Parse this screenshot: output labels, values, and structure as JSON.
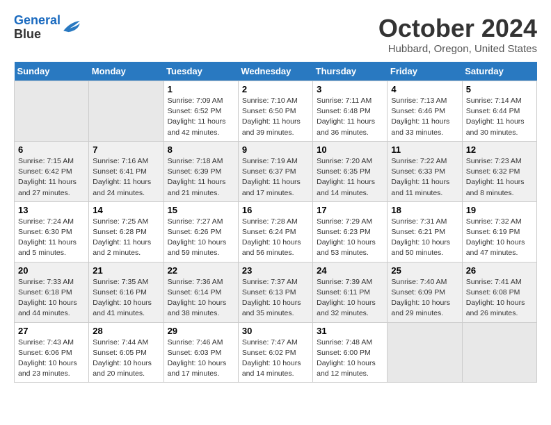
{
  "header": {
    "logo_line1": "General",
    "logo_line2": "Blue",
    "title": "October 2024",
    "location": "Hubbard, Oregon, United States"
  },
  "weekdays": [
    "Sunday",
    "Monday",
    "Tuesday",
    "Wednesday",
    "Thursday",
    "Friday",
    "Saturday"
  ],
  "weeks": [
    [
      {
        "day": "",
        "info": "",
        "empty": true
      },
      {
        "day": "",
        "info": "",
        "empty": true
      },
      {
        "day": "1",
        "info": "Sunrise: 7:09 AM\nSunset: 6:52 PM\nDaylight: 11 hours and 42 minutes."
      },
      {
        "day": "2",
        "info": "Sunrise: 7:10 AM\nSunset: 6:50 PM\nDaylight: 11 hours and 39 minutes."
      },
      {
        "day": "3",
        "info": "Sunrise: 7:11 AM\nSunset: 6:48 PM\nDaylight: 11 hours and 36 minutes."
      },
      {
        "day": "4",
        "info": "Sunrise: 7:13 AM\nSunset: 6:46 PM\nDaylight: 11 hours and 33 minutes."
      },
      {
        "day": "5",
        "info": "Sunrise: 7:14 AM\nSunset: 6:44 PM\nDaylight: 11 hours and 30 minutes."
      }
    ],
    [
      {
        "day": "6",
        "info": "Sunrise: 7:15 AM\nSunset: 6:42 PM\nDaylight: 11 hours and 27 minutes."
      },
      {
        "day": "7",
        "info": "Sunrise: 7:16 AM\nSunset: 6:41 PM\nDaylight: 11 hours and 24 minutes."
      },
      {
        "day": "8",
        "info": "Sunrise: 7:18 AM\nSunset: 6:39 PM\nDaylight: 11 hours and 21 minutes."
      },
      {
        "day": "9",
        "info": "Sunrise: 7:19 AM\nSunset: 6:37 PM\nDaylight: 11 hours and 17 minutes."
      },
      {
        "day": "10",
        "info": "Sunrise: 7:20 AM\nSunset: 6:35 PM\nDaylight: 11 hours and 14 minutes."
      },
      {
        "day": "11",
        "info": "Sunrise: 7:22 AM\nSunset: 6:33 PM\nDaylight: 11 hours and 11 minutes."
      },
      {
        "day": "12",
        "info": "Sunrise: 7:23 AM\nSunset: 6:32 PM\nDaylight: 11 hours and 8 minutes."
      }
    ],
    [
      {
        "day": "13",
        "info": "Sunrise: 7:24 AM\nSunset: 6:30 PM\nDaylight: 11 hours and 5 minutes."
      },
      {
        "day": "14",
        "info": "Sunrise: 7:25 AM\nSunset: 6:28 PM\nDaylight: 11 hours and 2 minutes."
      },
      {
        "day": "15",
        "info": "Sunrise: 7:27 AM\nSunset: 6:26 PM\nDaylight: 10 hours and 59 minutes."
      },
      {
        "day": "16",
        "info": "Sunrise: 7:28 AM\nSunset: 6:24 PM\nDaylight: 10 hours and 56 minutes."
      },
      {
        "day": "17",
        "info": "Sunrise: 7:29 AM\nSunset: 6:23 PM\nDaylight: 10 hours and 53 minutes."
      },
      {
        "day": "18",
        "info": "Sunrise: 7:31 AM\nSunset: 6:21 PM\nDaylight: 10 hours and 50 minutes."
      },
      {
        "day": "19",
        "info": "Sunrise: 7:32 AM\nSunset: 6:19 PM\nDaylight: 10 hours and 47 minutes."
      }
    ],
    [
      {
        "day": "20",
        "info": "Sunrise: 7:33 AM\nSunset: 6:18 PM\nDaylight: 10 hours and 44 minutes."
      },
      {
        "day": "21",
        "info": "Sunrise: 7:35 AM\nSunset: 6:16 PM\nDaylight: 10 hours and 41 minutes."
      },
      {
        "day": "22",
        "info": "Sunrise: 7:36 AM\nSunset: 6:14 PM\nDaylight: 10 hours and 38 minutes."
      },
      {
        "day": "23",
        "info": "Sunrise: 7:37 AM\nSunset: 6:13 PM\nDaylight: 10 hours and 35 minutes."
      },
      {
        "day": "24",
        "info": "Sunrise: 7:39 AM\nSunset: 6:11 PM\nDaylight: 10 hours and 32 minutes."
      },
      {
        "day": "25",
        "info": "Sunrise: 7:40 AM\nSunset: 6:09 PM\nDaylight: 10 hours and 29 minutes."
      },
      {
        "day": "26",
        "info": "Sunrise: 7:41 AM\nSunset: 6:08 PM\nDaylight: 10 hours and 26 minutes."
      }
    ],
    [
      {
        "day": "27",
        "info": "Sunrise: 7:43 AM\nSunset: 6:06 PM\nDaylight: 10 hours and 23 minutes."
      },
      {
        "day": "28",
        "info": "Sunrise: 7:44 AM\nSunset: 6:05 PM\nDaylight: 10 hours and 20 minutes."
      },
      {
        "day": "29",
        "info": "Sunrise: 7:46 AM\nSunset: 6:03 PM\nDaylight: 10 hours and 17 minutes."
      },
      {
        "day": "30",
        "info": "Sunrise: 7:47 AM\nSunset: 6:02 PM\nDaylight: 10 hours and 14 minutes."
      },
      {
        "day": "31",
        "info": "Sunrise: 7:48 AM\nSunset: 6:00 PM\nDaylight: 10 hours and 12 minutes."
      },
      {
        "day": "",
        "info": "",
        "empty": true
      },
      {
        "day": "",
        "info": "",
        "empty": true
      }
    ]
  ]
}
